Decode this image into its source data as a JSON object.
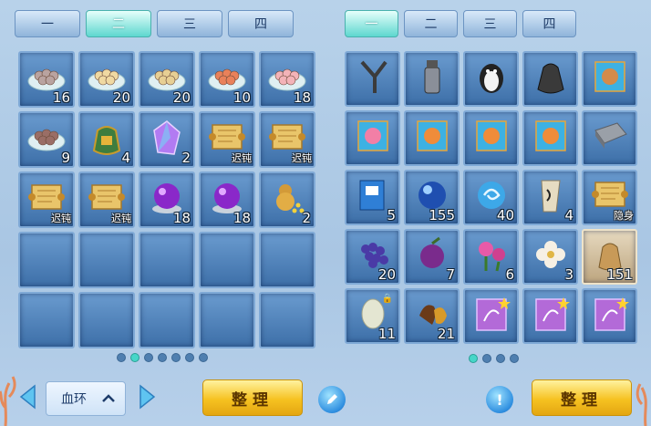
{
  "left_inventory": {
    "tabs": [
      "一",
      "二",
      "三",
      "四"
    ],
    "active_tab": 1,
    "slots": [
      {
        "icon": "dumpling-plate-icon",
        "count": "16",
        "tag": ""
      },
      {
        "icon": "egg-plate-icon",
        "count": "20",
        "tag": ""
      },
      {
        "icon": "pastry-plate-icon",
        "count": "20",
        "tag": ""
      },
      {
        "icon": "shrimp-plate-icon",
        "count": "10",
        "tag": ""
      },
      {
        "icon": "peach-bun-plate-icon",
        "count": "18",
        "tag": ""
      },
      {
        "icon": "meatball-plate-icon",
        "count": "9",
        "tag": ""
      },
      {
        "icon": "money-bag-icon",
        "count": "4",
        "tag": ""
      },
      {
        "icon": "crystal-gem-icon",
        "count": "2",
        "tag": ""
      },
      {
        "icon": "scroll-icon",
        "count": "",
        "tag": "迟钝"
      },
      {
        "icon": "scroll-icon",
        "count": "",
        "tag": "迟钝"
      },
      {
        "icon": "scroll-icon",
        "count": "",
        "tag": "迟钝"
      },
      {
        "icon": "scroll-icon",
        "count": "",
        "tag": "迟钝"
      },
      {
        "icon": "purple-orb-icon",
        "count": "18",
        "tag": ""
      },
      {
        "icon": "purple-orb-icon",
        "count": "18",
        "tag": ""
      },
      {
        "icon": "gourd-gold-icon",
        "count": "2",
        "tag": ""
      },
      {
        "icon": "",
        "count": "",
        "tag": ""
      },
      {
        "icon": "",
        "count": "",
        "tag": ""
      },
      {
        "icon": "",
        "count": "",
        "tag": ""
      },
      {
        "icon": "",
        "count": "",
        "tag": ""
      },
      {
        "icon": "",
        "count": "",
        "tag": ""
      },
      {
        "icon": "",
        "count": "",
        "tag": ""
      },
      {
        "icon": "",
        "count": "",
        "tag": ""
      },
      {
        "icon": "",
        "count": "",
        "tag": ""
      },
      {
        "icon": "",
        "count": "",
        "tag": ""
      },
      {
        "icon": "",
        "count": "",
        "tag": ""
      }
    ],
    "page_count": 7,
    "active_page": 1,
    "category_select": "血环",
    "sort_label": "整理"
  },
  "right_inventory": {
    "tabs": [
      "一",
      "二",
      "三",
      "四"
    ],
    "active_tab": 0,
    "slots": [
      {
        "icon": "slingshot-icon",
        "count": "",
        "tag": "",
        "highlight": false,
        "lock": false
      },
      {
        "icon": "shaker-bottle-icon",
        "count": "",
        "tag": "",
        "highlight": false,
        "lock": false
      },
      {
        "icon": "penguin-doll-icon",
        "count": "",
        "tag": "",
        "highlight": false,
        "lock": false
      },
      {
        "icon": "black-pouch-icon",
        "count": "",
        "tag": "",
        "highlight": false,
        "lock": false
      },
      {
        "icon": "pet-card-bear-icon",
        "count": "",
        "tag": "",
        "highlight": false,
        "lock": false
      },
      {
        "icon": "pet-card-girl-icon",
        "count": "",
        "tag": "",
        "highlight": false,
        "lock": false
      },
      {
        "icon": "pet-card-orange-icon",
        "count": "",
        "tag": "",
        "highlight": false,
        "lock": false
      },
      {
        "icon": "pet-card-orange-icon",
        "count": "",
        "tag": "",
        "highlight": false,
        "lock": false
      },
      {
        "icon": "pet-card-orange-icon",
        "count": "",
        "tag": "",
        "highlight": false,
        "lock": false
      },
      {
        "icon": "iron-ingot-icon",
        "count": "",
        "tag": "",
        "highlight": false,
        "lock": false
      },
      {
        "icon": "blue-book-icon",
        "count": "5",
        "tag": "",
        "highlight": false,
        "lock": false
      },
      {
        "icon": "blue-orb-icon",
        "count": "155",
        "tag": "",
        "highlight": false,
        "lock": false
      },
      {
        "icon": "swirl-orb-icon",
        "count": "40",
        "tag": "",
        "highlight": false,
        "lock": false
      },
      {
        "icon": "paper-talisman-icon",
        "count": "4",
        "tag": "",
        "highlight": false,
        "lock": false
      },
      {
        "icon": "scroll-icon",
        "count": "",
        "tag": "隐身",
        "highlight": false,
        "lock": false
      },
      {
        "icon": "grape-berry-icon",
        "count": "20",
        "tag": "",
        "highlight": false,
        "lock": false
      },
      {
        "icon": "plum-fruit-icon",
        "count": "7",
        "tag": "",
        "highlight": false,
        "lock": false
      },
      {
        "icon": "pink-flower-icon",
        "count": "6",
        "tag": "",
        "highlight": false,
        "lock": false
      },
      {
        "icon": "white-flower-icon",
        "count": "3",
        "tag": "",
        "highlight": false,
        "lock": false
      },
      {
        "icon": "cloth-bag-icon",
        "count": "151",
        "tag": "",
        "highlight": true,
        "lock": false
      },
      {
        "icon": "jade-stone-icon",
        "count": "11",
        "tag": "",
        "highlight": false,
        "lock": true
      },
      {
        "icon": "chestnut-icon",
        "count": "21",
        "tag": "",
        "highlight": false,
        "lock": false
      },
      {
        "icon": "starred-purple-card-icon",
        "count": "",
        "tag": "",
        "highlight": false,
        "lock": false
      },
      {
        "icon": "starred-purple-card-icon",
        "count": "",
        "tag": "",
        "highlight": false,
        "lock": false
      },
      {
        "icon": "starred-purple-card-icon",
        "count": "",
        "tag": "",
        "highlight": false,
        "lock": false
      }
    ],
    "page_count": 4,
    "active_page": 0,
    "sort_label": "整理"
  },
  "colors": {
    "accent_tab": "#5ed7cf",
    "sort_button": "#f6c221",
    "slot": "#3d6fa8"
  }
}
